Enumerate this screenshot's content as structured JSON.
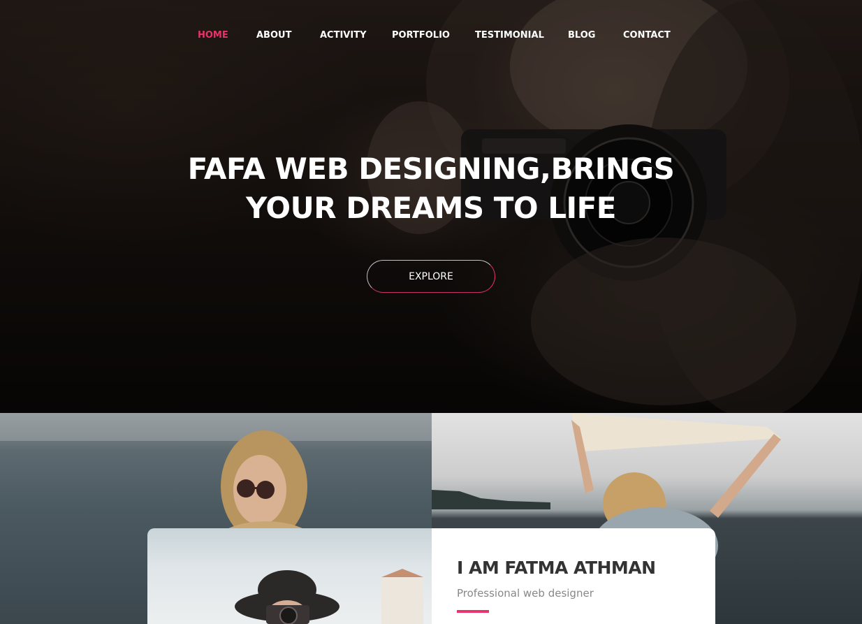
{
  "nav": {
    "items": [
      {
        "label": "HOME",
        "active": true
      },
      {
        "label": "ABOUT",
        "active": false
      },
      {
        "label": "ACTIVITY",
        "active": false
      },
      {
        "label": "PORTFOLIO",
        "active": false
      },
      {
        "label": "TESTIMONIAL",
        "active": false
      },
      {
        "label": "BLOG",
        "active": false
      },
      {
        "label": "CONTACT",
        "active": false
      }
    ]
  },
  "hero": {
    "title_line1": "FAFA WEB DESIGNING,BRINGS",
    "title_line2": "YOUR DREAMS TO LIFE",
    "cta_label": "EXPLORE"
  },
  "about": {
    "name": "I AM FATMA ATHMAN",
    "role": "Professional web designer"
  },
  "colors": {
    "accent": "#e8336b",
    "hero_overlay": "#0c0908",
    "card_background": "#ffffff",
    "heading_text": "#333333",
    "subtext": "#888888"
  }
}
